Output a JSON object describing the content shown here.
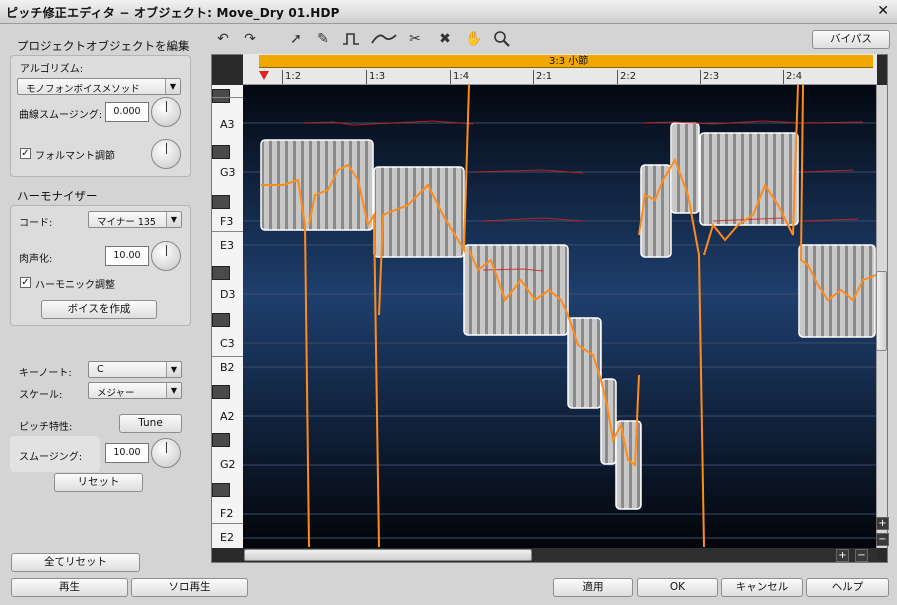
{
  "window": {
    "title": "ピッチ修正エディタ − オブジェクト: Move_Dry 01.HDP",
    "close": "✕"
  },
  "left": {
    "edit_title": "プロジェクトオブジェクトを編集",
    "algorithm_label": "アルゴリズム:",
    "algorithm_value": "モノフォンボイスメソッド",
    "curve_smoothing_label": "曲線スムージング:",
    "curve_smoothing_value": "0.000",
    "formant_label": "フォルマント調節",
    "harmonizer_title": "ハーモナイザー",
    "chord_label": "コード:",
    "chord_value": "マイナー 135",
    "humanize_label": "肉声化:",
    "humanize_value": "10.00",
    "harmonic_label": "ハーモニック調整",
    "create_voice": "ボイスを作成",
    "key_label": "キーノート:",
    "key_value": "C",
    "scale_label": "スケール:",
    "scale_value": "メジャー",
    "pitch_char_label": "ピッチ特性:",
    "tune_button": "Tune",
    "smoothing_label": "スムージング:",
    "smoothing_value": "10.00",
    "reset_button": "リセット",
    "reset_all": "全てリセット",
    "play": "再生",
    "solo_play": "ソロ再生"
  },
  "toolbar": {
    "bypass": "バイパス",
    "tools": [
      "undo-icon",
      "redo-icon",
      "pointer-icon",
      "pencil-icon",
      "square-wave-icon",
      "smooth-wave-icon",
      "scissors-icon",
      "delete-icon",
      "hand-icon",
      "zoom-icon"
    ]
  },
  "ruler": {
    "section": "3:3 小節",
    "ticks": [
      "1:2",
      "1:3",
      "1:4",
      "2:1",
      "2:2",
      "2:3",
      "2:4"
    ]
  },
  "notes": [
    "A3",
    "G3",
    "F3",
    "E3",
    "D3",
    "C3",
    "B2",
    "A2",
    "G2",
    "F2",
    "E2"
  ],
  "footer": {
    "apply": "適用",
    "ok": "OK",
    "cancel": "キャンセル",
    "help": "ヘルプ"
  },
  "colors": {
    "playhead": "#e02020",
    "pitch_curve": "#ff8c1a",
    "ruler_bar": "#f0a800"
  }
}
